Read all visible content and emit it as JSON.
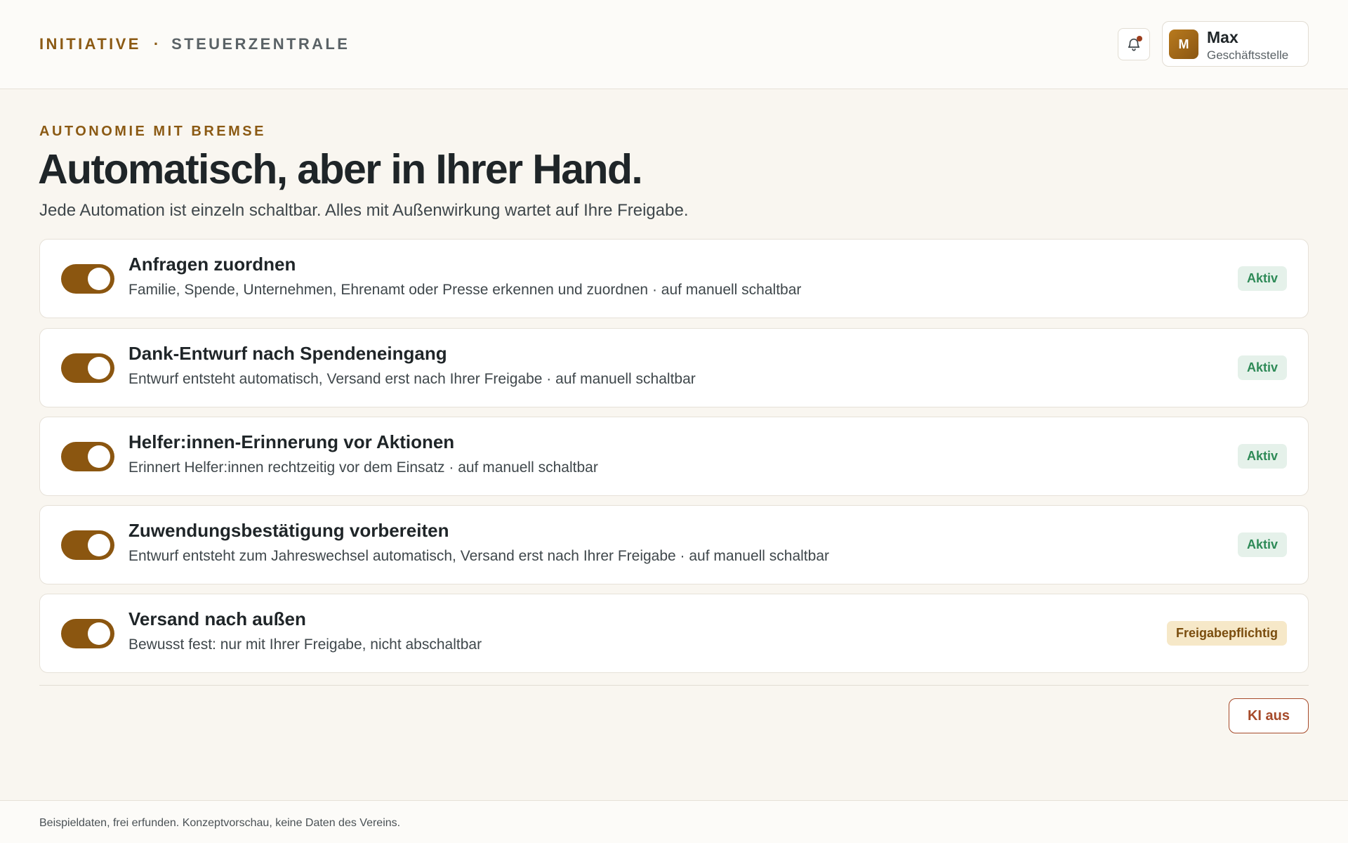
{
  "header": {
    "brand_primary": "INITIATIVE",
    "brand_separator": "·",
    "brand_secondary": "STEUERZENTRALE",
    "notification_icon": "bell-icon",
    "user": {
      "initial": "M",
      "name": "Max",
      "role": "Geschäftsstelle"
    }
  },
  "hero": {
    "eyebrow": "AUTONOMIE MIT BREMSE",
    "title": "Automatisch, aber in Ihrer Hand.",
    "subtitle": "Jede Automation ist einzeln schaltbar. Alles mit Außenwirkung wartet auf Ihre Freigabe."
  },
  "automations": [
    {
      "title": "Anfragen zuordnen",
      "description": "Familie, Spende, Unternehmen, Ehrenamt oder Presse erkennen und zuordnen · auf manuell schaltbar",
      "enabled": true,
      "status": "Aktiv"
    },
    {
      "title": "Dank-Entwurf nach Spendeneingang",
      "description": "Entwurf entsteht automatisch, Versand erst nach Ihrer Freigabe · auf manuell schaltbar",
      "enabled": true,
      "status": "Aktiv"
    },
    {
      "title": "Helfer:innen-Erinnerung vor Aktionen",
      "description": "Erinnert Helfer:innen rechtzeitig vor dem Einsatz · auf manuell schaltbar",
      "enabled": true,
      "status": "Aktiv"
    },
    {
      "title": "Zuwendungsbestätigung vorbereiten",
      "description": "Entwurf entsteht zum Jahreswechsel automatisch, Versand erst nach Ihrer Freigabe · auf manuell schaltbar",
      "enabled": true,
      "status": "Aktiv"
    },
    {
      "title": "Versand nach außen",
      "description": "Bewusst fest: nur mit Ihrer Freigabe, nicht abschaltbar",
      "enabled": true,
      "status": "Freigabepflichtig"
    }
  ],
  "actions": {
    "ki_off_label": "KI aus"
  },
  "footer": {
    "note": "Beispieldaten, frei erfunden. Konzeptvorschau, keine Daten des Vereins."
  },
  "colors": {
    "accent": "#8b5610",
    "active_badge_bg": "#e5f1ea",
    "active_badge_text": "#2e8a57",
    "approval_badge_bg": "#f6e8c8",
    "approval_badge_text": "#7a4d0e",
    "danger": "#a64a2a"
  }
}
